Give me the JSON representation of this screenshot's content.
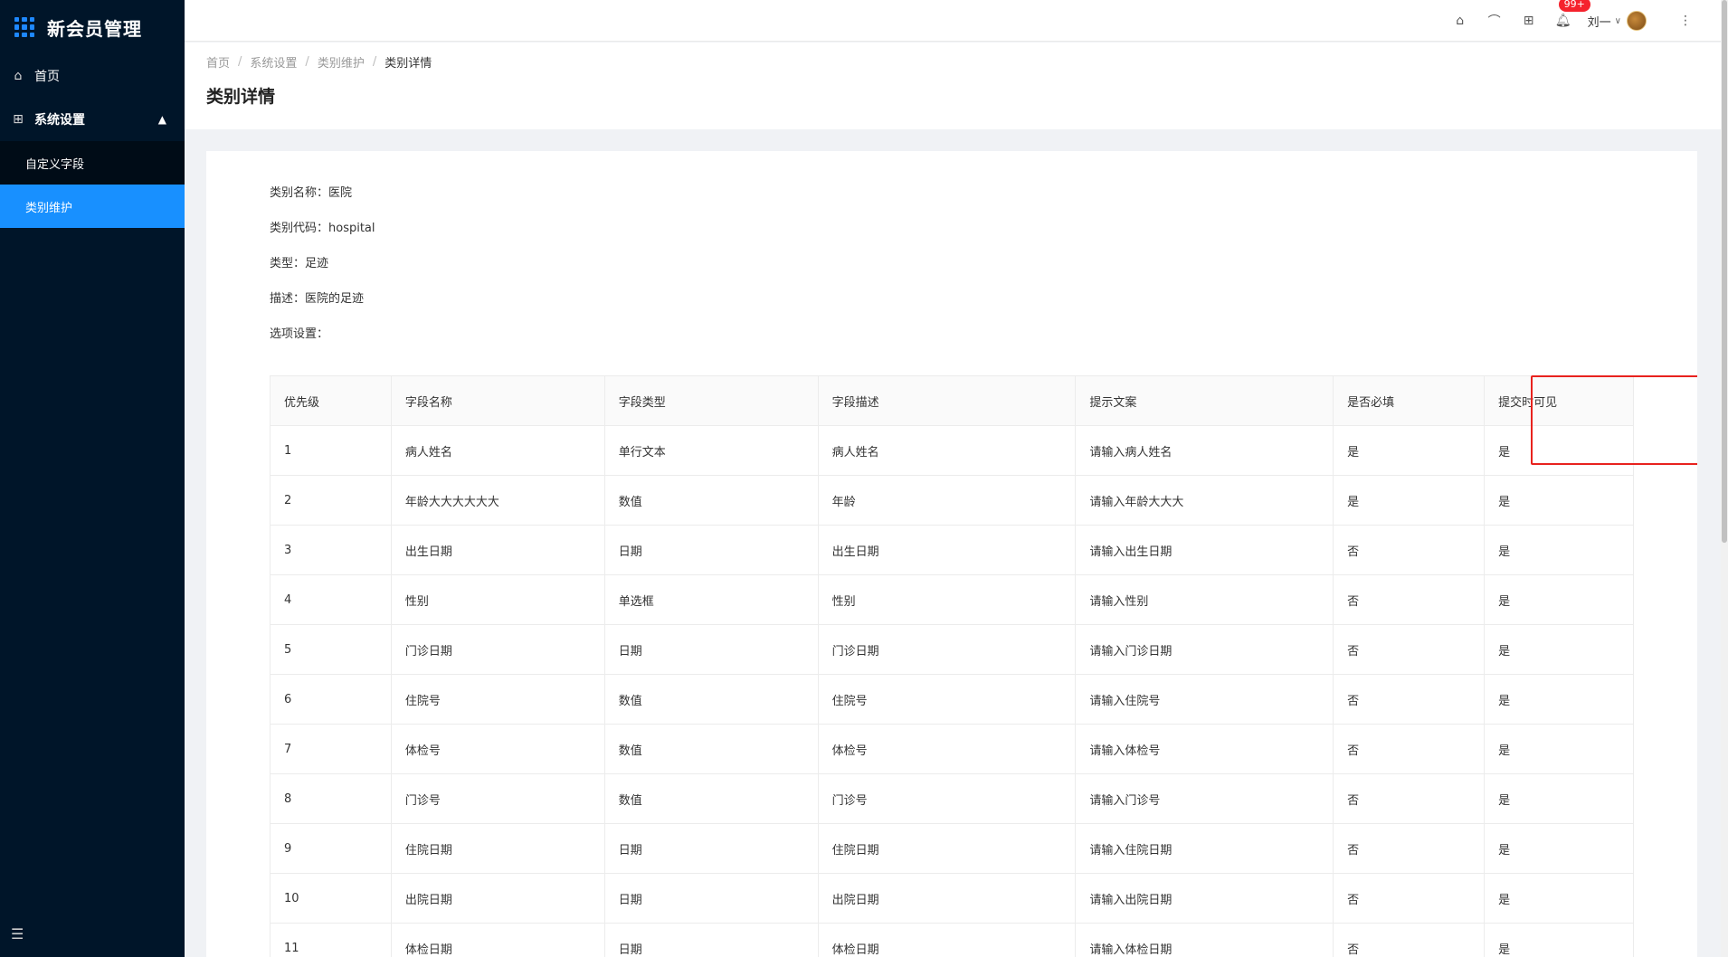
{
  "app": {
    "title": "新会员管理"
  },
  "sidebar": {
    "items": [
      {
        "label": "首页",
        "icon": "home-icon"
      },
      {
        "label": "系统设置",
        "icon": "appstore-icon"
      }
    ],
    "submenu": [
      {
        "label": "自定义字段"
      },
      {
        "label": "类别维护"
      }
    ]
  },
  "header": {
    "badge_count": "99+",
    "user_name": "刘一"
  },
  "breadcrumb": [
    "首页",
    "系统设置",
    "类别维护",
    "类别详情"
  ],
  "page_title": "类别详情",
  "info": {
    "name": "类别名称：医院",
    "code": "类别代码：hospital",
    "type": "类型：足迹",
    "desc": "描述：医院的足迹",
    "options": "选项设置："
  },
  "table": {
    "columns": [
      "优先级",
      "字段名称",
      "字段类型",
      "字段描述",
      "提示文案",
      "是否必填",
      "提交时可见"
    ],
    "rows": [
      [
        "1",
        "病人姓名",
        "单行文本",
        "病人姓名",
        "请输入病人姓名",
        "是",
        "是"
      ],
      [
        "2",
        "年龄大大大大大大",
        "数值",
        "年龄",
        "请输入年龄大大大",
        "是",
        "是"
      ],
      [
        "3",
        "出生日期",
        "日期",
        "出生日期",
        "请输入出生日期",
        "否",
        "是"
      ],
      [
        "4",
        "性别",
        "单选框",
        "性别",
        "请输入性别",
        "否",
        "是"
      ],
      [
        "5",
        "门诊日期",
        "日期",
        "门诊日期",
        "请输入门诊日期",
        "否",
        "是"
      ],
      [
        "6",
        "住院号",
        "数值",
        "住院号",
        "请输入住院号",
        "否",
        "是"
      ],
      [
        "7",
        "体检号",
        "数值",
        "体检号",
        "请输入体检号",
        "否",
        "是"
      ],
      [
        "8",
        "门诊号",
        "数值",
        "门诊号",
        "请输入门诊号",
        "否",
        "是"
      ],
      [
        "9",
        "住院日期",
        "日期",
        "住院日期",
        "请输入住院日期",
        "否",
        "是"
      ],
      [
        "10",
        "出院日期",
        "日期",
        "出院日期",
        "请输入出院日期",
        "否",
        "是"
      ],
      [
        "11",
        "体检日期",
        "日期",
        "体检日期",
        "请输入体检日期",
        "否",
        "是"
      ]
    ]
  },
  "colors": {
    "sidebar_bg": "#001529",
    "active_bg": "#1890ff",
    "highlight": "#e8221e",
    "badge": "#f5222d"
  }
}
